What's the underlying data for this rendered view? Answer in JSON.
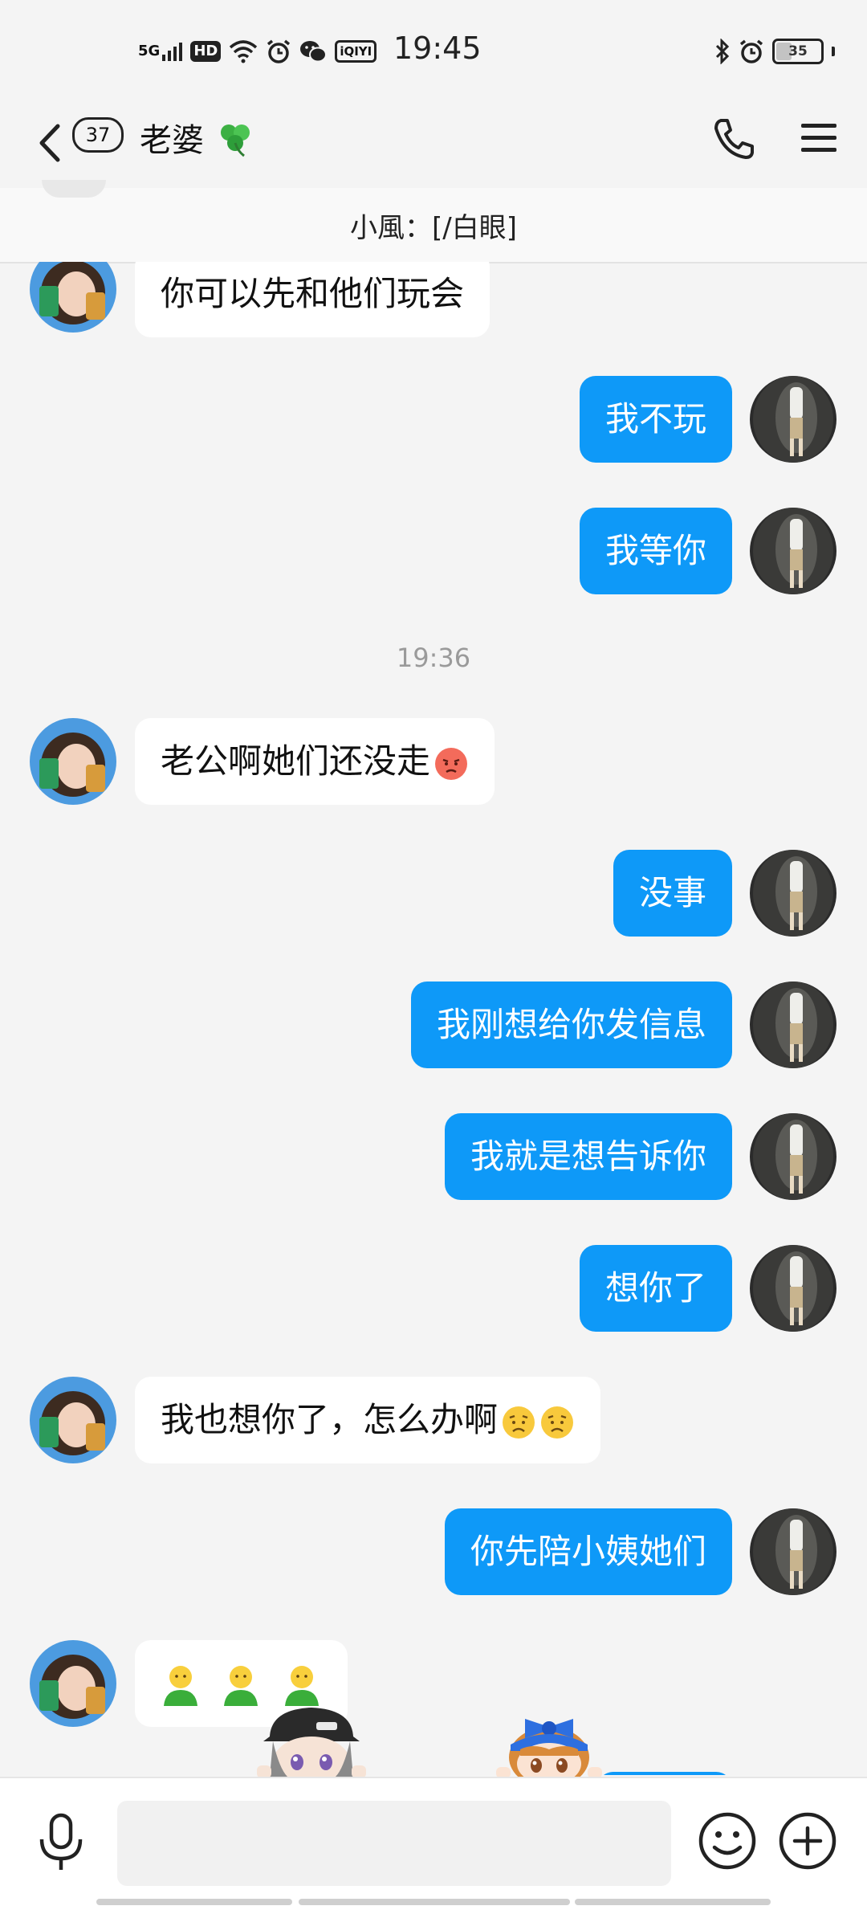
{
  "status_bar": {
    "network": "5G",
    "hd": "HD",
    "iqiyi": "iQIYI",
    "time": "19:45",
    "battery": "35",
    "battery_fraction": 0.35,
    "icons": [
      "signal-icon",
      "hd-icon",
      "wifi-icon",
      "alarm-icon",
      "wechat-icon",
      "iqiyi-icon",
      "bluetooth-icon",
      "alarm-icon",
      "battery-icon"
    ]
  },
  "header": {
    "unread_count": "37",
    "contact_name": "老婆",
    "decoration": "clover-icon"
  },
  "pinned": {
    "text": "小風：[/白眼]"
  },
  "messages": [
    {
      "side": "in",
      "text": "你可以先和他们玩会"
    },
    {
      "side": "out",
      "text": "我不玩"
    },
    {
      "side": "out",
      "text": "我等你"
    },
    {
      "type": "time",
      "text": "19:36"
    },
    {
      "side": "in",
      "text": "老公啊她们还没走",
      "emoji": [
        "pouting-face"
      ]
    },
    {
      "side": "out",
      "text": "没事"
    },
    {
      "side": "out",
      "text": "我刚想给你发信息"
    },
    {
      "side": "out",
      "text": "我就是想告诉你"
    },
    {
      "side": "out",
      "text": "想你了"
    },
    {
      "side": "in",
      "text": "我也想你了，怎么办啊",
      "emoji": [
        "sad-face",
        "sad-face"
      ]
    },
    {
      "side": "out",
      "text": "你先陪小姨她们"
    },
    {
      "side": "in",
      "text": "",
      "emoji": [
        "green-figure",
        "green-figure",
        "green-figure"
      ]
    }
  ],
  "input": {
    "placeholder": "",
    "value": ""
  },
  "colors": {
    "outgoing_bubble": "#0e99f8",
    "incoming_bubble": "#ffffff",
    "background": "#f4f4f4"
  }
}
